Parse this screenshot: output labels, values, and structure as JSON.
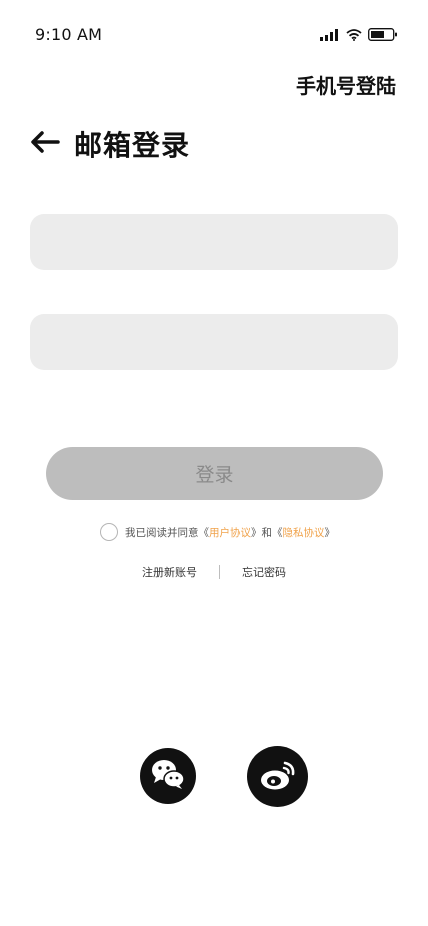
{
  "status_bar": {
    "time": "9:10 AM"
  },
  "header": {
    "phone_login_label": "手机号登陆",
    "title": "邮箱登录",
    "back_icon": "arrow-left-icon"
  },
  "form": {
    "email_value": "",
    "password_value": "",
    "login_label": "登录"
  },
  "agreement": {
    "prefix": "我已阅读并同意《",
    "user_agreement": "用户协议",
    "middle": "》和《",
    "privacy_policy": "隐私协议",
    "suffix": "》",
    "checked": false
  },
  "links": {
    "register_label": "注册新账号",
    "forgot_label": "忘记密码"
  },
  "social": {
    "wechat_icon": "wechat-icon",
    "weibo_icon": "weibo-icon"
  },
  "colors": {
    "accent": "#f0a24a",
    "input_bg": "#ececec",
    "button_disabled_bg": "#bdbdbd"
  }
}
